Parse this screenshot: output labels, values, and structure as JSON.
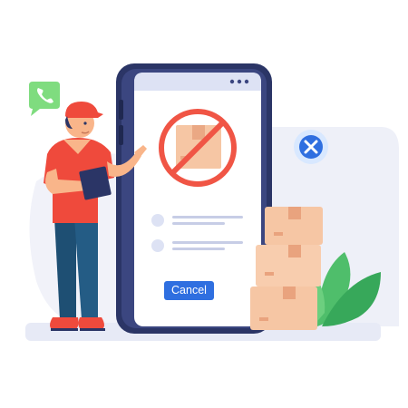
{
  "screen": {
    "cancel_label": "Cancel"
  },
  "icons": {
    "phone_bubble": "phone-icon",
    "close_badge": "close-icon",
    "prohibited_box": "no-package-icon",
    "menu_dots": "more-dots-icon"
  },
  "colors": {
    "accent_blue": "#2f6fe0",
    "prohibit_red": "#f05545",
    "phone_green": "#7fdc7f",
    "box_peach": "#f6c6a4",
    "frame_navy": "#2b3566",
    "courier_red": "#ef4a3c"
  }
}
